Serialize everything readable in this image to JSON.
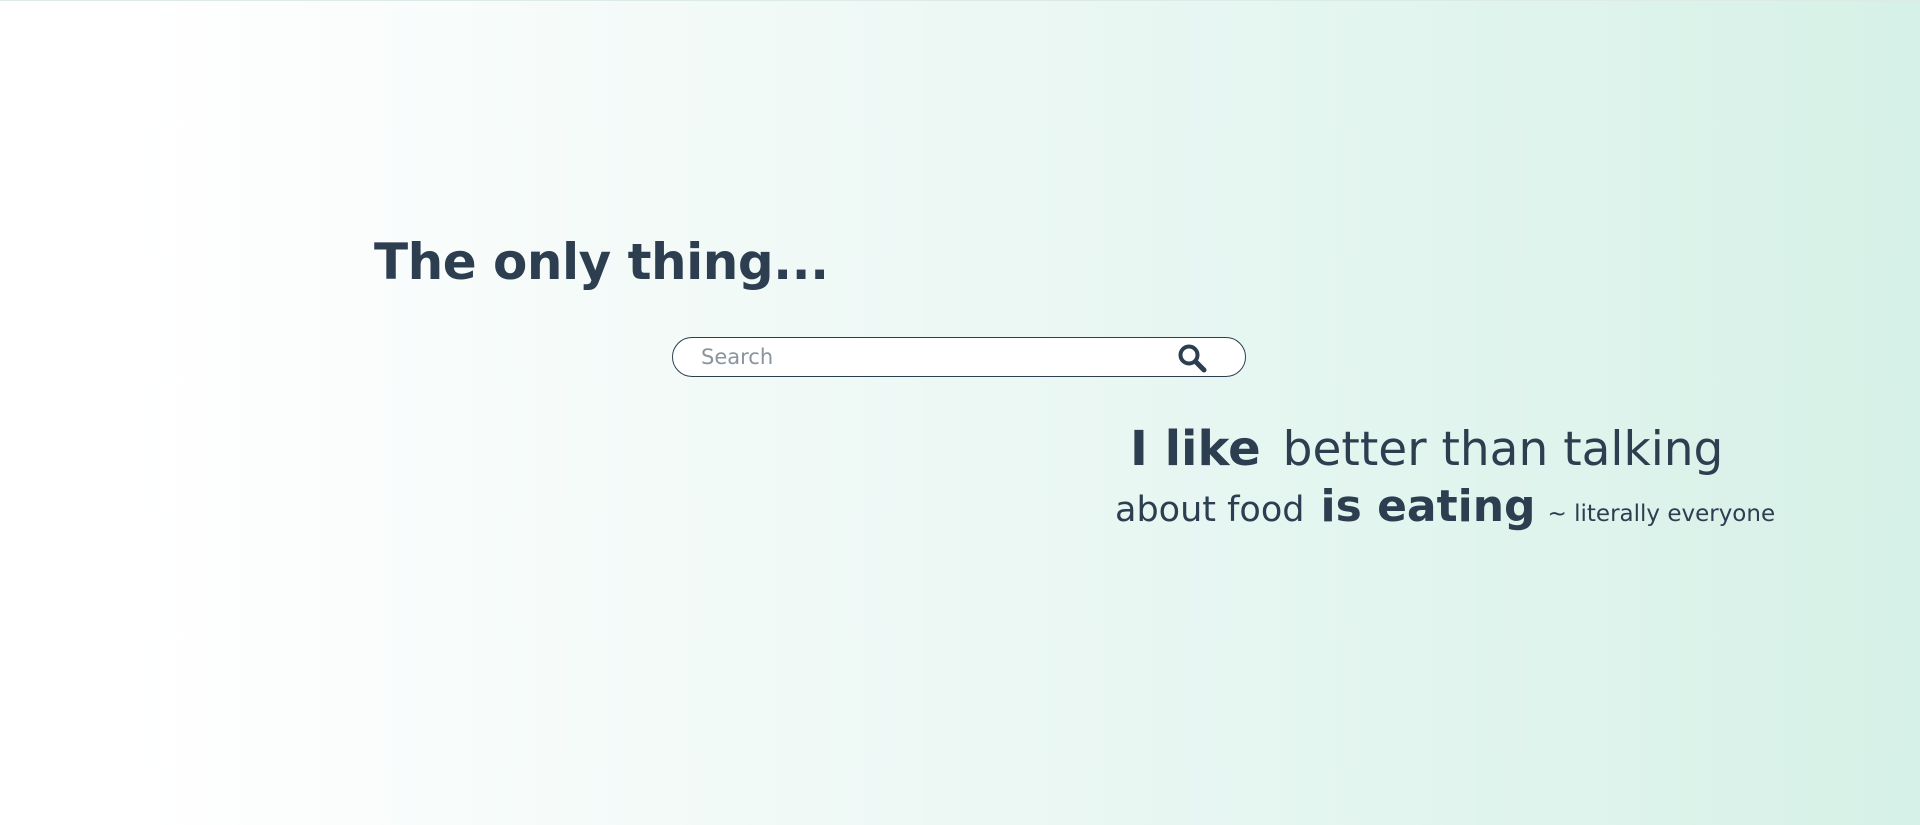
{
  "hero": {
    "heading": "The only thing...",
    "search": {
      "placeholder": "Search",
      "value": "",
      "icon": "search-icon"
    },
    "quote": {
      "line1_bold": "I like",
      "line1_light": "better than talking",
      "line2_light": "about food",
      "line2_bold": "is eating",
      "attribution": "~ literally everyone"
    }
  },
  "colors": {
    "text": "#2c3e50",
    "gradient_start": "#ffffff",
    "gradient_end": "#d6f1e7",
    "placeholder": "#8a949e"
  }
}
